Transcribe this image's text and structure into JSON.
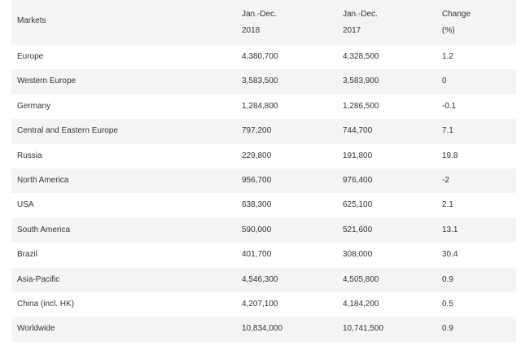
{
  "table": {
    "headers": [
      {
        "line1": "Markets",
        "line2": ""
      },
      {
        "line1": "Jan.-Dec.",
        "line2": "2018"
      },
      {
        "line1": "Jan.-Dec.",
        "line2": "2017"
      },
      {
        "line1": "Change",
        "line2": "(%)"
      }
    ],
    "rows": [
      {
        "market": "Europe",
        "y2018": "4,380,700",
        "y2017": "4,328,500",
        "change": "1.2"
      },
      {
        "market": "Western Europe",
        "y2018": "3,583,500",
        "y2017": "3,583,900",
        "change": "0"
      },
      {
        "market": "Germany",
        "y2018": "1,284,800",
        "y2017": "1,286,500",
        "change": "-0.1"
      },
      {
        "market": "Central and Eastern Europe",
        "y2018": "797,200",
        "y2017": "744,700",
        "change": "7.1"
      },
      {
        "market": "Russia",
        "y2018": "229,800",
        "y2017": "191,800",
        "change": "19.8"
      },
      {
        "market": "North America",
        "y2018": "956,700",
        "y2017": "976,400",
        "change": "-2"
      },
      {
        "market": "USA",
        "y2018": "638,300",
        "y2017": "625,100",
        "change": "2.1"
      },
      {
        "market": "South America",
        "y2018": "590,000",
        "y2017": "521,600",
        "change": "13.1"
      },
      {
        "market": "Brazil",
        "y2018": "401,700",
        "y2017": "308,000",
        "change": "30.4"
      },
      {
        "market": "Asia-Pacific",
        "y2018": "4,546,300",
        "y2017": "4,505,800",
        "change": "0.9"
      },
      {
        "market": "China (incl. HK)",
        "y2018": "4,207,100",
        "y2017": "4,184,200",
        "change": "0.5"
      },
      {
        "market": "Worldwide",
        "y2018": "10,834,000",
        "y2017": "10,741,500",
        "change": "0.9"
      }
    ]
  }
}
